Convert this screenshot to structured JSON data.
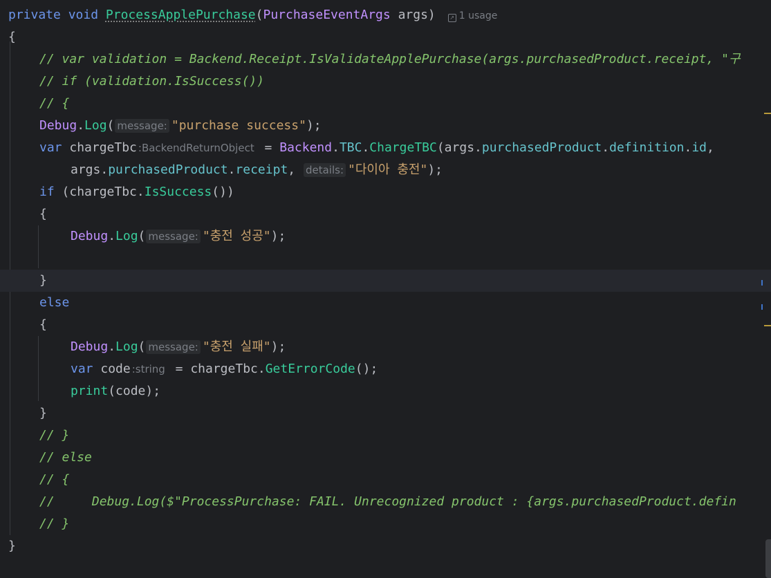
{
  "editor": {
    "usage_hint": "1 usage",
    "lines": {
      "l1": {
        "kw1": "private",
        "kw2": "void",
        "method": "ProcessApplePurchase",
        "p_open": "(",
        "ptype": "PurchaseEventArgs",
        "pname": " args",
        "p_close": ")"
      },
      "l2": {
        "text": "{"
      },
      "l3": {
        "comment": "// var validation = Backend.Receipt.IsValidateApplePurchase(args.purchasedProduct.receipt, \"구"
      },
      "l4": {
        "comment": "// if (validation.IsSuccess())"
      },
      "l5": {
        "comment": "// {"
      },
      "l6": {
        "cls": "Debug",
        "dot": ".",
        "fn": "Log",
        "open": "(",
        "hint": "message:",
        "str": "\"purchase success\"",
        "close": ");"
      },
      "l7": {
        "kw": "var",
        "var": " chargeTbc",
        "hint": ":BackendReturnObject",
        "eq": " = ",
        "cls": "Backend",
        "dot1": ".",
        "sub": "TBC",
        "dot2": ".",
        "fn": "ChargeTBC",
        "open": "(args.",
        "p1": "purchasedProduct",
        "d1": ".",
        "p2": "definition",
        "d2": ".",
        "p3": "id",
        "tail": ","
      },
      "l8": {
        "pre": "args.",
        "p1": "purchasedProduct",
        "d1": ".",
        "p2": "receipt",
        "comma": ", ",
        "hint": "details:",
        "str": "\"다이아 충전\"",
        "close": ");"
      },
      "l9": {
        "kw": "if",
        "open": " (chargeTbc.",
        "fn": "IsSuccess",
        "close": "())"
      },
      "l10": {
        "text": "{"
      },
      "l11": {
        "cls": "Debug",
        "dot": ".",
        "fn": "Log",
        "open": "(",
        "hint": "message:",
        "str": "\"충전 성공\"",
        "close": ");"
      },
      "l13": {
        "text": "}"
      },
      "l14": {
        "kw": "else"
      },
      "l15": {
        "text": "{"
      },
      "l16": {
        "cls": "Debug",
        "dot": ".",
        "fn": "Log",
        "open": "(",
        "hint": "message:",
        "str": "\"충전 실패\"",
        "close": ");"
      },
      "l17": {
        "kw": "var",
        "var": " code",
        "hint": ":string",
        "eq": " = chargeTbc.",
        "fn": "GetErrorCode",
        "close": "();"
      },
      "l18": {
        "fn": "print",
        "close": "(code);"
      },
      "l19": {
        "text": "}"
      },
      "l20": {
        "comment": "// }"
      },
      "l21": {
        "comment": "// else"
      },
      "l22": {
        "comment": "// {"
      },
      "l23": {
        "comment": "//     Debug.Log($\"ProcessPurchase: FAIL. Unrecognized product : {args.purchasedProduct.defin"
      },
      "l24": {
        "comment": "// }"
      },
      "l25": {
        "text": "}"
      }
    }
  },
  "colors": {
    "background": "#1e1f22",
    "keyword": "#6c95eb",
    "type": "#c191ff",
    "method": "#39cc9b",
    "string": "#c9a26d",
    "comment": "#85c46c",
    "property": "#66c3cc"
  },
  "icons": {
    "usage": "usage-link-icon"
  }
}
